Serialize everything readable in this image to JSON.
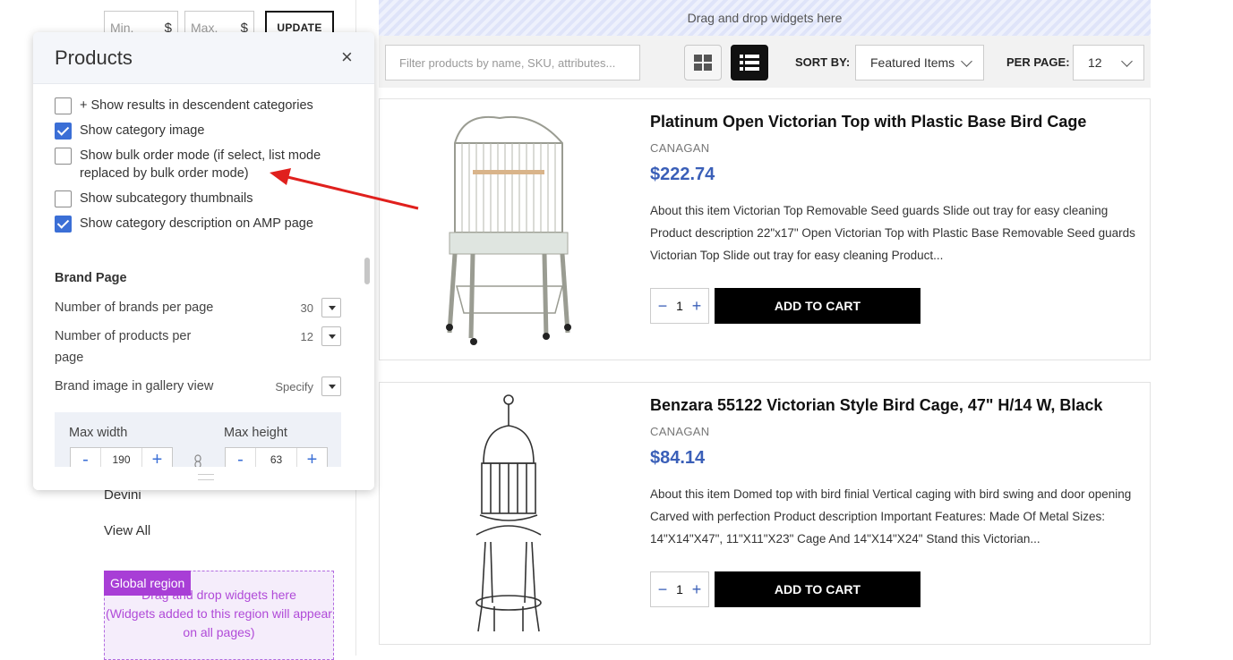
{
  "sidebar": {
    "price_min_placeholder": "Min.",
    "price_max_placeholder": "Max.",
    "currency": "$",
    "update_label": "UPDATE",
    "brand_item": "Devini",
    "view_all": "View All"
  },
  "global_region": {
    "tag": "Global region",
    "text_line1": "Drag and drop widgets here",
    "text_line2": "(Widgets added to this region will appear",
    "text_line3": "on all pages)"
  },
  "top_region": {
    "text": "Drag and drop widgets here"
  },
  "toolbar": {
    "filter_placeholder": "Filter products by name, SKU, attributes...",
    "sort_label": "SORT BY:",
    "sort_value": "Featured Items",
    "per_page_label": "PER PAGE:",
    "per_page_value": "12"
  },
  "products": [
    {
      "title": "Platinum Open Victorian Top with Plastic Base Bird Cage",
      "brand": "CANAGAN",
      "price": "$222.74",
      "desc_line1": "About this item Victorian Top Removable Seed guards Slide out tray for easy cleaning",
      "desc_line2": "Product description 22\"x17\" Open Victorian Top with Plastic Base Removable Seed guards",
      "desc_line3": "Victorian Top Slide out tray for easy cleaning Product...",
      "qty": "1",
      "cart_label": "ADD TO CART"
    },
    {
      "title": "Benzara 55122 Victorian Style Bird Cage, 47\" H/14 W, Black",
      "brand": "CANAGAN",
      "price": "$84.14",
      "desc_line1": "About this item Domed top with bird finial Vertical caging with bird swing and door opening",
      "desc_line2": "Carved with perfection Product description Important Features: Made Of Metal Sizes:",
      "desc_line3": "14\"X14\"X47\", 11\"X11\"X23\" Cage And 14\"X14\"X24\" Stand this Victorian...",
      "qty": "1",
      "cart_label": "ADD TO CART"
    }
  ],
  "panel": {
    "title": "Products",
    "close": "×",
    "options": [
      {
        "label": "+ Show results in descendent categories",
        "checked": false
      },
      {
        "label": "Show category image",
        "checked": true
      },
      {
        "label_line1": "Show bulk order mode (if select, list mode",
        "label_line2": "replaced by bulk order mode)",
        "checked": false
      },
      {
        "label": "Show subcategory thumbnails",
        "checked": false
      },
      {
        "label": "Show category description on AMP page",
        "checked": true
      }
    ],
    "brand_page": {
      "title": "Brand Page",
      "brands_per_page_label": "Number of brands per page",
      "brands_per_page_value": "30",
      "products_per_page_label_line1": "Number of products per",
      "products_per_page_label_line2": "page",
      "products_per_page_value": "12",
      "gallery_image_label": "Brand image in gallery view",
      "gallery_image_value": "Specify",
      "max_width_label": "Max width",
      "max_width_value": "190",
      "max_height_label": "Max height",
      "max_height_value": "63",
      "minus": "-",
      "plus": "+"
    }
  },
  "colors": {
    "accent": "#3a5fb8",
    "annotation_arrow": "#e0201d",
    "global_region": "#a83ed6"
  }
}
